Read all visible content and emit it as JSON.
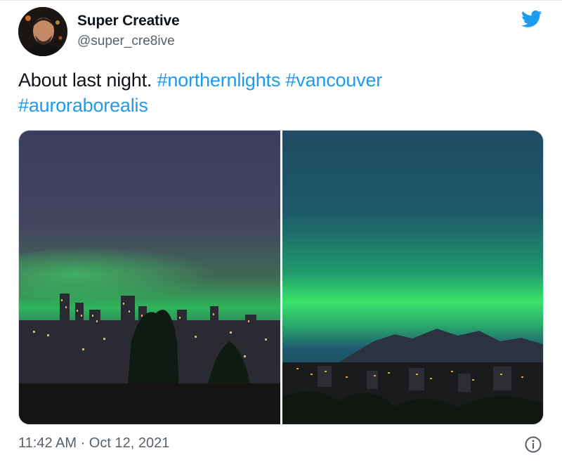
{
  "author": {
    "name": "Super Creative",
    "handle": "@super_cre8ive"
  },
  "tweet": {
    "text_plain": "About last night.",
    "hashtags": [
      "#northernlights",
      "#vancouver",
      "#auroraborealis"
    ]
  },
  "media": {
    "photos": [
      {
        "icon": "aurora-city-skyline-photo"
      },
      {
        "icon": "aurora-mountains-photo"
      }
    ]
  },
  "footer": {
    "timestamp": "11:42 AM · Oct 12, 2021"
  },
  "icons": {
    "brand": "twitter-bird-icon",
    "info": "info-icon"
  },
  "colors": {
    "hashtag": "#1d9bf0",
    "twitter_blue": "#1d9bf0",
    "muted": "#586068"
  }
}
